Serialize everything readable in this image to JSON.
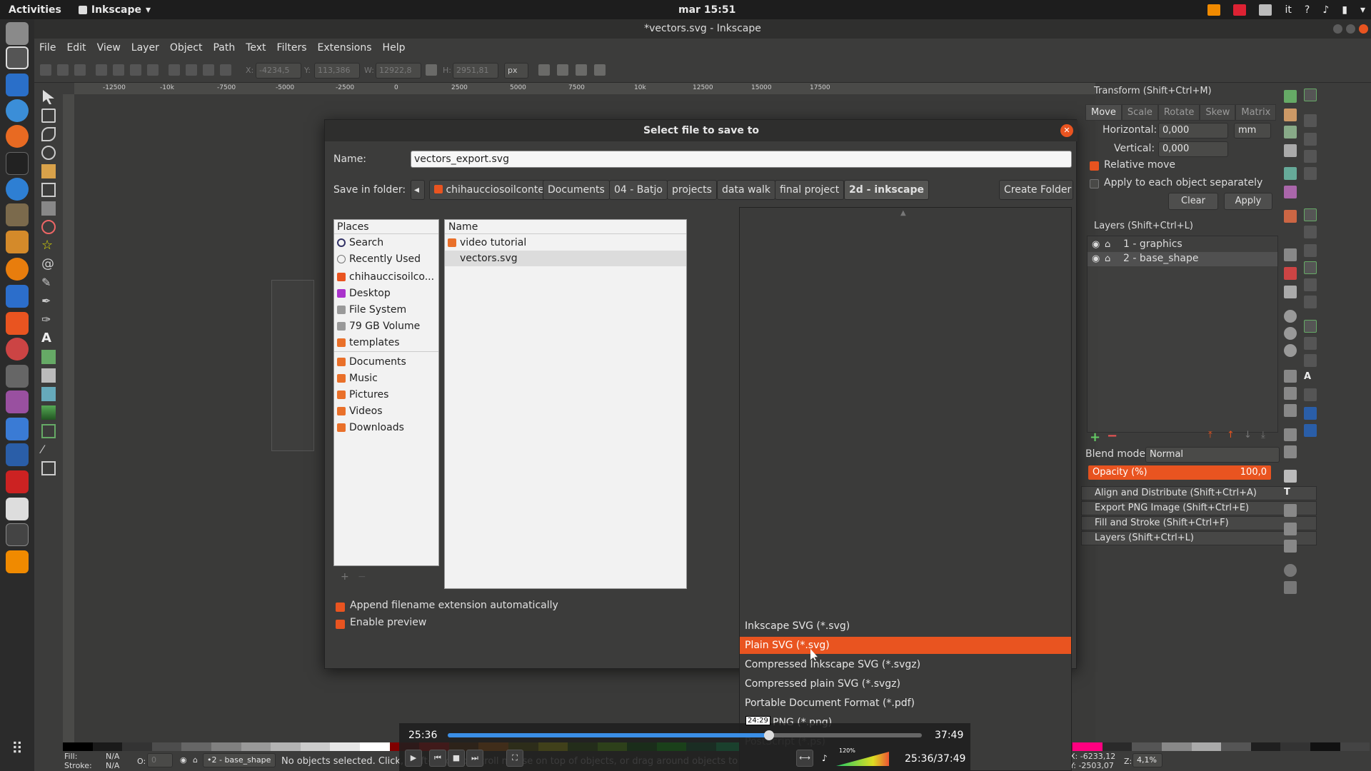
{
  "topbar": {
    "activities": "Activities",
    "app_name": "Inkscape",
    "clock": "mar 15:51",
    "lang": "it"
  },
  "window": {
    "title": "*vectors.svg - Inkscape",
    "menu": [
      "File",
      "Edit",
      "View",
      "Layer",
      "Object",
      "Path",
      "Text",
      "Filters",
      "Extensions",
      "Help"
    ]
  },
  "toolbar": {
    "x_label": "X:",
    "x_value": "-4234,5",
    "y_label": "Y:",
    "y_value": "113,386",
    "w_label": "W:",
    "w_value": "12922,8",
    "h_label": "H:",
    "h_value": "2951,81",
    "unit": "px"
  },
  "ruler": {
    "ticks": [
      "-12500",
      "-10k",
      "-7500",
      "-5000",
      "-2500",
      "0",
      "2500",
      "5000",
      "7500",
      "10k",
      "12500",
      "15000",
      "17500"
    ]
  },
  "transform_panel": {
    "title": "Transform (Shift+Ctrl+M)",
    "tabs": [
      "Move",
      "Scale",
      "Rotate",
      "Skew",
      "Matrix"
    ],
    "horizontal_label": "Horizontal:",
    "horizontal_value": "0,000",
    "vertical_label": "Vertical:",
    "vertical_value": "0,000",
    "unit": "mm",
    "relative_move": "Relative move",
    "apply_each": "Apply to each object separately",
    "clear": "Clear",
    "apply": "Apply"
  },
  "layers_panel": {
    "title": "Layers (Shift+Ctrl+L)",
    "layers": [
      "1 - graphics",
      "2 - base_shape"
    ],
    "blend_label": "Blend mode:",
    "blend_value": "Normal",
    "opacity_label": "Opacity (%)",
    "opacity_value": "100,0"
  },
  "collapsed_panels": [
    "Align and Distribute (Shift+Ctrl+A)",
    "Export PNG Image (Shift+Ctrl+E)",
    "Fill and Stroke (Shift+Ctrl+F)",
    "Layers (Shift+Ctrl+L)"
  ],
  "status": {
    "fill_label": "Fill:",
    "fill_value": "N/A",
    "stroke_label": "Stroke:",
    "stroke_value": "N/A",
    "opacity_label": "O:",
    "opacity_value": "0",
    "layer": "•2 - base_shape",
    "message": "No objects selected. Click, Shift+click, or scroll mouse on top of objects, or drag around objects to select.",
    "coords_x": "X: -6233,12",
    "coords_y": "Y: -2503,07",
    "zoom_label": "Z:",
    "zoom": "4,1%"
  },
  "dialog": {
    "title": "Select file to save to",
    "name_label": "Name:",
    "name_value": "vectors_export.svg",
    "folder_label": "Save in folder:",
    "breadcrumbs": [
      "chihaucciosoilconte",
      "Documents",
      "04 - Batjo",
      "projects",
      "data walk",
      "final project",
      "2d - inkscape"
    ],
    "create_folder": "Create Folder",
    "places_header": "Places",
    "places": [
      "Search",
      "Recently Used",
      "chihauccisoilco...",
      "Desktop",
      "File System",
      "79 GB Volume",
      "templates",
      "Documents",
      "Music",
      "Pictures",
      "Videos",
      "Downloads"
    ],
    "files_header": "Name",
    "files": [
      "video tutorial",
      "vectors.svg"
    ],
    "append_ext": "Append filename extension automatically",
    "enable_preview": "Enable preview"
  },
  "filter_options": [
    "Inkscape SVG (*.svg)",
    "Plain SVG (*.svg)",
    "Compressed Inkscape SVG (*.svgz)",
    "Compressed plain SVG (*.svgz)",
    "Portable Document Format (*.pdf)",
    "PNG (*.png)",
    "PostScript (*.ps)"
  ],
  "selected_filter_index": 1,
  "video": {
    "current": "25:36",
    "total": "37:49",
    "tooltip": "24:29",
    "progress": 0.677,
    "combined": "25:36/37:49",
    "volume": "120%"
  },
  "colors": {
    "accent": "#e95420",
    "panel_bg": "#3c3c3b"
  }
}
